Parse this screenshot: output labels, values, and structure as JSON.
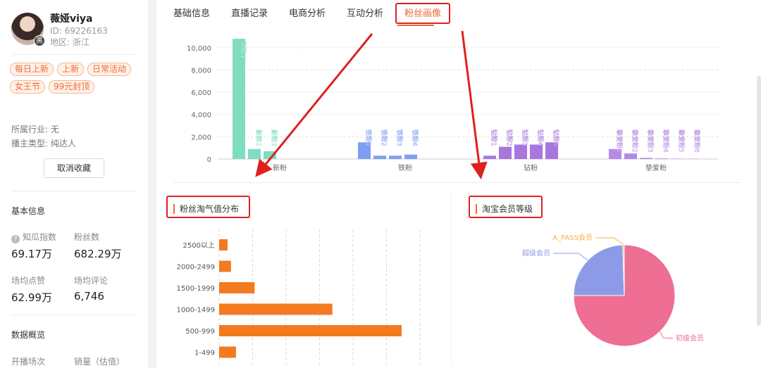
{
  "profile": {
    "name": "薇娅viya",
    "id_text": "ID:  69226163",
    "region_text": "地区:  浙江",
    "avatar_badge": "黑"
  },
  "tags": [
    "每日上新",
    "上新",
    "日常活动",
    "女王节",
    "99元封顶"
  ],
  "industry_text": "所属行业: 无",
  "anchor_type_text": "播主类型: 纯达人",
  "cancel_favorite_label": "取消收藏",
  "basic_info": {
    "title": "基本信息",
    "zhigua_label": "知瓜指数",
    "zhigua_value": "69.17万",
    "fans_label": "粉丝数",
    "fans_value": "682.29万",
    "avg_likes_label": "场均点赞",
    "avg_likes_value": "62.99万",
    "avg_comments_label": "场均评论",
    "avg_comments_value": "6,746"
  },
  "data_overview": {
    "title": "数据概览",
    "sessions_label": "开播场次",
    "sales_label": "销量（估值）"
  },
  "tabs": [
    "基础信息",
    "直播记录",
    "电商分析",
    "互动分析",
    "粉丝画像"
  ],
  "active_tab": 4,
  "colors": {
    "accent": "#f06a35",
    "highlight_box": "#e02020",
    "arrow": "#e02020"
  },
  "panels": {
    "taoqi_title": "粉丝淘气值分布",
    "member_title": "淘宝会员等级"
  },
  "chart_data": [
    {
      "type": "bar",
      "categories": [
        "新粉",
        "铁粉",
        "钻粉",
        "挚爱粉"
      ],
      "ylim": [
        0,
        11000
      ],
      "yticks": [
        "0",
        "2,000",
        "4,000",
        "6,000",
        "8,000",
        "10,000"
      ],
      "ytick_values": [
        0,
        2000,
        4000,
        6000,
        8000,
        10000
      ],
      "groups": [
        {
          "color": "#7fdcc0",
          "bars": [
            {
              "value": 10800,
              "label": "新粉1"
            },
            {
              "value": 900,
              "label": "新粉2"
            },
            {
              "value": 700,
              "label": "新粉3"
            }
          ]
        },
        {
          "color": "#7f9ef2",
          "bars": [
            {
              "value": 1500,
              "label": "铁粉1"
            },
            {
              "value": 300,
              "label": "铁粉2"
            },
            {
              "value": 300,
              "label": "铁粉3"
            },
            {
              "value": 400,
              "label": "铁粉4"
            }
          ]
        },
        {
          "color": "#a777dd",
          "bars": [
            {
              "value": 300,
              "label": "钻粉1"
            },
            {
              "value": 1100,
              "label": "钻粉2"
            },
            {
              "value": 1300,
              "label": "钻粉3"
            },
            {
              "value": 1300,
              "label": "钻粉4"
            },
            {
              "value": 1500,
              "label": "钻粉5"
            }
          ]
        },
        {
          "color": "#b48ae6",
          "bars": [
            {
              "value": 900,
              "label": "挚爱粉1"
            },
            {
              "value": 500,
              "label": "挚爱粉2"
            },
            {
              "value": 100,
              "label": "挚爱粉3"
            },
            {
              "value": 50,
              "label": "挚爱粉4"
            },
            {
              "value": 30,
              "label": "挚爱粉5"
            },
            {
              "value": 20,
              "label": "挚爱粉6"
            }
          ]
        }
      ]
    },
    {
      "type": "bar",
      "orientation": "horizontal",
      "title": "粉丝淘气值分布",
      "categories": [
        "2500以上",
        "2000-2499",
        "1500-1999",
        "1000-1499",
        "500-999",
        "1-499"
      ],
      "values": [
        5,
        7,
        21,
        67,
        108,
        10
      ],
      "xlim": [
        0,
        118
      ],
      "color": "#f47a20"
    },
    {
      "type": "pie",
      "title": "淘宝会员等级",
      "slices": [
        {
          "label": "初级会员",
          "value": 75,
          "color": "#ee6f93"
        },
        {
          "label": "超级会员",
          "value": 24.5,
          "color": "#8c9ae8"
        },
        {
          "label": "A_PASS会员",
          "value": 0.5,
          "color": "#f6b04d"
        }
      ]
    }
  ]
}
